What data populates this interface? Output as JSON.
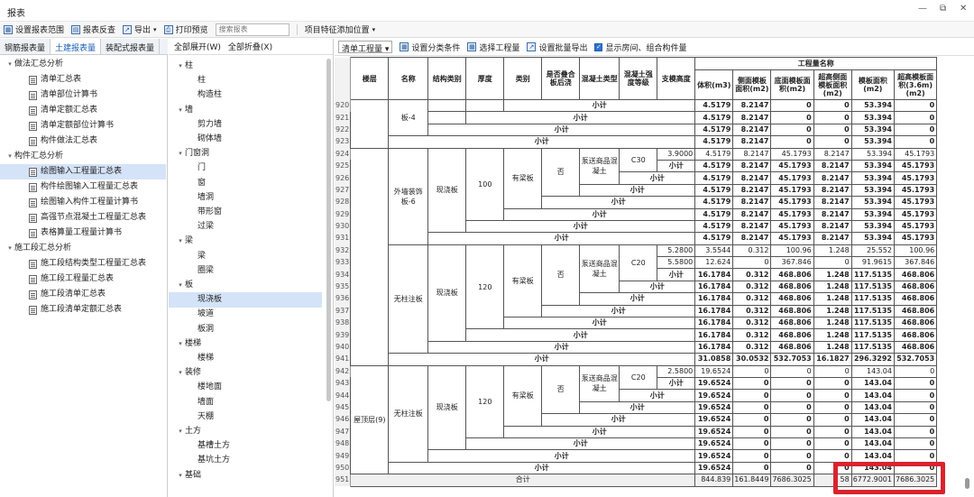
{
  "window": {
    "title": "报表",
    "controls": [
      "—",
      "⧉",
      "✕"
    ]
  },
  "toolbar": {
    "items": [
      "设置报表范围",
      "报表反查",
      "导出",
      "打印预览"
    ],
    "search_placeholder": "搜索报表",
    "location_label": "项目特征添加位置"
  },
  "left_tabs": [
    "钢筋报表量",
    "土建报表量",
    "装配式报表量"
  ],
  "left_tree": [
    {
      "label": "做法汇总分析",
      "level": 0
    },
    {
      "label": "清单汇总表",
      "level": 1
    },
    {
      "label": "清单部位计算书",
      "level": 1
    },
    {
      "label": "清单定额汇总表",
      "level": 1
    },
    {
      "label": "清单定额部位计算书",
      "level": 1
    },
    {
      "label": "构件做法汇总表",
      "level": 1
    },
    {
      "label": "构件汇总分析",
      "level": 0
    },
    {
      "label": "绘图输入工程量汇总表",
      "level": 1,
      "selected": true
    },
    {
      "label": "构件绘图输入工程量汇总表",
      "level": 1
    },
    {
      "label": "绘图输入构件工程量计算书",
      "level": 1
    },
    {
      "label": "高强节点混凝土工程量汇总表",
      "level": 1
    },
    {
      "label": "表格算量工程量计算书",
      "level": 1
    },
    {
      "label": "施工段汇总分析",
      "level": 0
    },
    {
      "label": "施工段结构类型工程量汇总表",
      "level": 1
    },
    {
      "label": "施工段工程量汇总表",
      "level": 1
    },
    {
      "label": "施工段清单汇总表",
      "level": 1
    },
    {
      "label": "施工段清单定额汇总表",
      "level": 1
    }
  ],
  "mid_header": {
    "expand": "全部展开(W)",
    "collapse": "全部折叠(X)"
  },
  "mid_tree": [
    {
      "label": "柱",
      "level": 0
    },
    {
      "label": "柱",
      "level": 1
    },
    {
      "label": "构造柱",
      "level": 1
    },
    {
      "label": "墙",
      "level": 0
    },
    {
      "label": "剪力墙",
      "level": 1
    },
    {
      "label": "砌体墙",
      "level": 1
    },
    {
      "label": "门窗洞",
      "level": 0
    },
    {
      "label": "门",
      "level": 1
    },
    {
      "label": "窗",
      "level": 1
    },
    {
      "label": "墙洞",
      "level": 1
    },
    {
      "label": "带形窗",
      "level": 1
    },
    {
      "label": "过梁",
      "level": 1
    },
    {
      "label": "梁",
      "level": 0
    },
    {
      "label": "梁",
      "level": 1
    },
    {
      "label": "圈梁",
      "level": 1
    },
    {
      "label": "板",
      "level": 0
    },
    {
      "label": "现浇板",
      "level": 1,
      "selected": true
    },
    {
      "label": "坡道",
      "level": 1
    },
    {
      "label": "板洞",
      "level": 1
    },
    {
      "label": "楼梯",
      "level": 0
    },
    {
      "label": "楼梯",
      "level": 1
    },
    {
      "label": "装修",
      "level": 0
    },
    {
      "label": "楼地面",
      "level": 1
    },
    {
      "label": "墙面",
      "level": 1
    },
    {
      "label": "天棚",
      "level": 1
    },
    {
      "label": "土方",
      "level": 0
    },
    {
      "label": "基槽土方",
      "level": 1
    },
    {
      "label": "基坑土方",
      "level": 1
    },
    {
      "label": "基础",
      "level": 0
    }
  ],
  "right_toolbar": {
    "dropdown": "清单工程量",
    "items": [
      "设置分类条件",
      "选择工程量",
      "设置批量导出"
    ],
    "checkbox_label": "显示房间、组合构件量"
  },
  "table": {
    "headers": [
      "楼层",
      "名称",
      "结构类别",
      "厚度",
      "类别",
      "是否叠合板后浇",
      "混凝土类型",
      "混凝土强度等级",
      "支模高度"
    ],
    "group_header": "工程量名称",
    "qty_headers": [
      "体积(m3)",
      "侧面模板面积(m2)",
      "底面模板面积(m2)",
      "超高侧面模板面积(m2)",
      "模板面积(m2)",
      "超高模板面积(3.6m)(m2)"
    ],
    "subtotal": "小计",
    "total_label": "合计",
    "names": [
      "板-4",
      "外墙装饰板-6",
      "无柱注板",
      "无柱注板"
    ],
    "floor_label": "屋顶层(9)",
    "struct": "现浇板",
    "thick": [
      "100",
      "120",
      "120"
    ],
    "cat": "有梁板",
    "diehe": "否",
    "cotype": "泵送商品混凝土",
    "grade": [
      "C30",
      "C20",
      "C20"
    ],
    "heights": [
      "3.9000",
      "5.2800",
      "5.5800",
      "2.5800"
    ],
    "rownums": [
      "920",
      "921",
      "922",
      "923",
      "924",
      "925",
      "926",
      "927",
      "928",
      "929",
      "930",
      "931",
      "932",
      "933",
      "934",
      "935",
      "936",
      "937",
      "938",
      "939",
      "940",
      "941",
      "942",
      "943",
      "944",
      "945",
      "946",
      "947",
      "948",
      "949",
      "950",
      "951"
    ],
    "rows": [
      [
        "4.5179",
        "8.2147",
        "0",
        "0",
        "53.394",
        "0"
      ],
      [
        "4.5179",
        "8.2147",
        "0",
        "0",
        "53.394",
        "0"
      ],
      [
        "4.5179",
        "8.2147",
        "0",
        "0",
        "53.394",
        "0"
      ],
      [
        "4.5179",
        "8.2147",
        "0",
        "0",
        "53.394",
        "0"
      ],
      [
        "4.5179",
        "8.2147",
        "45.1793",
        "8.2147",
        "53.394",
        "45.1793"
      ],
      [
        "4.5179",
        "8.2147",
        "45.1793",
        "8.2147",
        "53.394",
        "45.1793"
      ],
      [
        "4.5179",
        "8.2147",
        "45.1793",
        "8.2147",
        "53.394",
        "45.1793"
      ],
      [
        "4.5179",
        "8.2147",
        "45.1793",
        "8.2147",
        "53.394",
        "45.1793"
      ],
      [
        "4.5179",
        "8.2147",
        "45.1793",
        "8.2147",
        "53.394",
        "45.1793"
      ],
      [
        "4.5179",
        "8.2147",
        "45.1793",
        "8.2147",
        "53.394",
        "45.1793"
      ],
      [
        "4.5179",
        "8.2147",
        "45.1793",
        "8.2147",
        "53.394",
        "45.1793"
      ],
      [
        "4.5179",
        "8.2147",
        "45.1793",
        "8.2147",
        "53.394",
        "45.1793"
      ],
      [
        "3.5544",
        "0.312",
        "100.96",
        "1.248",
        "25.552",
        "100.96"
      ],
      [
        "12.624",
        "0",
        "367.846",
        "0",
        "91.9615",
        "367.846"
      ],
      [
        "16.1784",
        "0.312",
        "468.806",
        "1.248",
        "117.5135",
        "468.806"
      ],
      [
        "16.1784",
        "0.312",
        "468.806",
        "1.248",
        "117.5135",
        "468.806"
      ],
      [
        "16.1784",
        "0.312",
        "468.806",
        "1.248",
        "117.5135",
        "468.806"
      ],
      [
        "16.1784",
        "0.312",
        "468.806",
        "1.248",
        "117.5135",
        "468.806"
      ],
      [
        "16.1784",
        "0.312",
        "468.806",
        "1.248",
        "117.5135",
        "468.806"
      ],
      [
        "16.1784",
        "0.312",
        "468.806",
        "1.248",
        "117.5135",
        "468.806"
      ],
      [
        "16.1784",
        "0.312",
        "468.806",
        "1.248",
        "117.5135",
        "468.806"
      ],
      [
        "31.0858",
        "30.0532",
        "532.7053",
        "16.1827",
        "296.3292",
        "532.7053"
      ],
      [
        "19.6524",
        "0",
        "0",
        "0",
        "143.04",
        "0"
      ],
      [
        "19.6524",
        "0",
        "0",
        "0",
        "143.04",
        "0"
      ],
      [
        "19.6524",
        "0",
        "0",
        "0",
        "143.04",
        "0"
      ],
      [
        "19.6524",
        "0",
        "0",
        "0",
        "143.04",
        "0"
      ],
      [
        "19.6524",
        "0",
        "0",
        "0",
        "143.04",
        "0"
      ],
      [
        "19.6524",
        "0",
        "0",
        "0",
        "143.04",
        "0"
      ],
      [
        "19.6524",
        "0",
        "0",
        "0",
        "143.04",
        "0"
      ],
      [
        "19.6524",
        "0",
        "0",
        "0",
        "143.04",
        "0"
      ],
      [
        "19.6524",
        "0",
        "0",
        "0",
        "143.04",
        "0"
      ],
      [
        "844.839",
        "161.8449",
        "7686.3025",
        "58",
        "6772.9001",
        "7686.3025"
      ]
    ]
  },
  "colors": {
    "highlight": "#d9232e",
    "selection": "#d4e3f7"
  }
}
